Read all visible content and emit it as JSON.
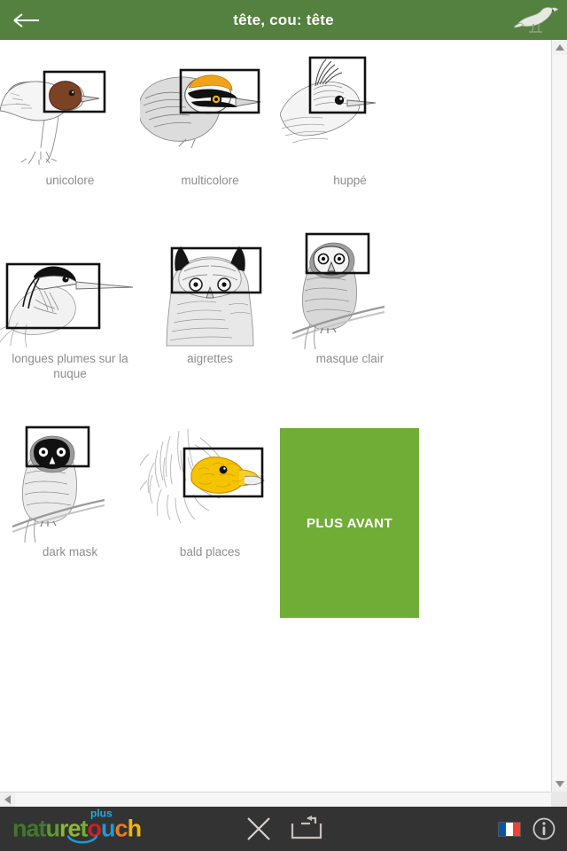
{
  "header": {
    "title": "tête, cou: tête",
    "back_icon": "arrow-left-icon",
    "bird_icon": "bird-icon",
    "bg_color": "#558140",
    "title_color": "#ffffff"
  },
  "content": {
    "rows": [
      {
        "cells": [
          {
            "id": "unicolore",
            "label": "unicolore",
            "image": "bird-head-brown-unicolour"
          },
          {
            "id": "multicolore",
            "label": "multicolore",
            "image": "bird-head-orange-multicolour"
          },
          {
            "id": "huppe",
            "label": "huppé",
            "image": "bird-head-crested"
          }
        ]
      },
      {
        "cells": [
          {
            "id": "longues-plumes",
            "label": "longues plumes sur la nuque",
            "image": "heron-head-long-nape-feathers"
          },
          {
            "id": "aigrettes",
            "label": "aigrettes",
            "image": "owl-head-ear-tufts"
          },
          {
            "id": "masque-clair",
            "label": "masque clair",
            "image": "owl-pale-facial-mask"
          }
        ]
      },
      {
        "cells": [
          {
            "id": "dark-mask",
            "label": "dark mask",
            "image": "owl-dark-facial-mask"
          },
          {
            "id": "bald-places",
            "label": "bald places",
            "image": "vulture-head-bald-yellow"
          }
        ]
      }
    ],
    "caption_color": "#8d8d8d"
  },
  "plus_avant": {
    "label": "PLUS AVANT",
    "bg_color": "#70ad36",
    "text_color": "#ffffff"
  },
  "scrollbars": {
    "vertical": {
      "up_icon": "triangle-up-icon",
      "down_icon": "triangle-down-icon"
    },
    "horizontal": {
      "left_icon": "triangle-left-icon",
      "right_icon": "triangle-right-icon"
    }
  },
  "bottom_bar": {
    "bg_color": "#333333",
    "logo": {
      "part_nat": "nat",
      "part_u": "u",
      "part_re": "re",
      "part_t": "t",
      "part_o": "o",
      "part_u2": "u",
      "part_c": "c",
      "part_h": "h",
      "sup": "plus",
      "colors": {
        "nat": "#3f7a2a",
        "u": "#5e9a2e",
        "re": "#8cb833",
        "t": "#73ad36",
        "o": "#cc2027",
        "u2": "#1b9ad6",
        "c": "#e87b20",
        "h": "#f2b705",
        "sup": "#29a8e0",
        "swoosh": "#1b9ad6"
      }
    },
    "close_icon": "close-icon",
    "return_icon": "return-box-icon",
    "flag_icon": "french-flag-icon",
    "flag_colors": [
      "#0055a4",
      "#ffffff",
      "#ef4135"
    ],
    "info_icon": "info-icon"
  }
}
